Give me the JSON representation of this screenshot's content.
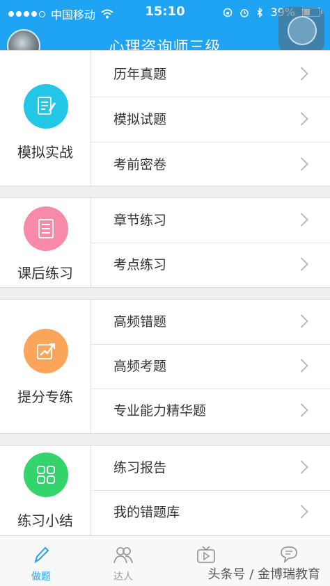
{
  "status_bar": {
    "carrier": "中国移动",
    "time": "15:10",
    "battery": "39%",
    "battery_level": 0.39,
    "signal_bars_filled": 4,
    "signal_bars_total": 5
  },
  "header": {
    "title": "心理咨询师三级"
  },
  "sections": [
    {
      "label": "模拟实战",
      "icon": "document-edit-icon",
      "color": "#22c7e8",
      "items": [
        "历年真题",
        "模拟试题",
        "考前密卷"
      ]
    },
    {
      "label": "课后练习",
      "icon": "checklist-icon",
      "color": "#f68aa8",
      "items": [
        "章节练习",
        "考点练习"
      ]
    },
    {
      "label": "提分专练",
      "icon": "trend-up-icon",
      "color": "#fba55b",
      "items": [
        "高频错题",
        "高频考题",
        "专业能力精华题"
      ]
    },
    {
      "label": "练习小结",
      "icon": "grid-icon",
      "color": "#34d46c",
      "items": [
        "练习报告",
        "我的错题库"
      ]
    }
  ],
  "tabbar": {
    "tabs": [
      {
        "label": "做题",
        "icon": "pen-icon",
        "active": true
      },
      {
        "label": "达人",
        "icon": "users-icon",
        "active": false
      },
      {
        "label": "",
        "icon": "tv-play-icon",
        "active": false
      },
      {
        "label": "",
        "icon": "chat-icon",
        "active": false
      }
    ]
  },
  "watermark": "头条号 / 金博瑞教育",
  "colors": {
    "brand": "#1ea4f3",
    "active_tab": "#1ea4f3"
  }
}
